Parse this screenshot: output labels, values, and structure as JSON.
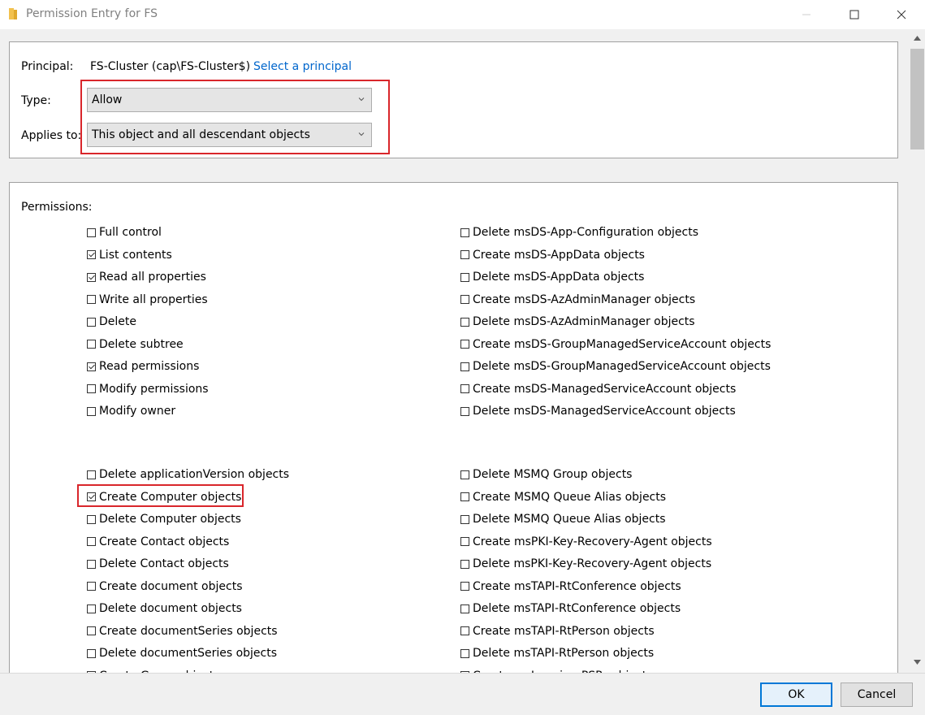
{
  "window": {
    "title": "Permission Entry for FS"
  },
  "principal": {
    "label": "Principal:",
    "value": "FS-Cluster (cap\\FS-Cluster$)",
    "link": "Select a principal"
  },
  "type": {
    "label": "Type:",
    "value": "Allow"
  },
  "applies_to": {
    "label": "Applies to:",
    "value": "This object and all descendant objects"
  },
  "permissions": {
    "header": "Permissions:",
    "left_group1": [
      {
        "label": "Full control",
        "checked": false
      },
      {
        "label": "List contents",
        "checked": true
      },
      {
        "label": "Read all properties",
        "checked": true
      },
      {
        "label": "Write all properties",
        "checked": false
      },
      {
        "label": "Delete",
        "checked": false
      },
      {
        "label": "Delete subtree",
        "checked": false
      },
      {
        "label": "Read permissions",
        "checked": true
      },
      {
        "label": "Modify permissions",
        "checked": false
      },
      {
        "label": "Modify owner",
        "checked": false
      }
    ],
    "right_group1": [
      {
        "label": "Delete msDS-App-Configuration objects",
        "checked": false
      },
      {
        "label": "Create msDS-AppData objects",
        "checked": false
      },
      {
        "label": "Delete msDS-AppData objects",
        "checked": false
      },
      {
        "label": "Create msDS-AzAdminManager objects",
        "checked": false
      },
      {
        "label": "Delete msDS-AzAdminManager objects",
        "checked": false
      },
      {
        "label": "Create msDS-GroupManagedServiceAccount objects",
        "checked": false
      },
      {
        "label": "Delete msDS-GroupManagedServiceAccount objects",
        "checked": false
      },
      {
        "label": "Create msDS-ManagedServiceAccount objects",
        "checked": false
      },
      {
        "label": "Delete msDS-ManagedServiceAccount objects",
        "checked": false
      }
    ],
    "left_group2": [
      {
        "label": "Delete applicationVersion objects",
        "checked": false
      },
      {
        "label": "Create Computer objects",
        "checked": true
      },
      {
        "label": "Delete Computer objects",
        "checked": false
      },
      {
        "label": "Create Contact objects",
        "checked": false
      },
      {
        "label": "Delete Contact objects",
        "checked": false
      },
      {
        "label": "Create document objects",
        "checked": false
      },
      {
        "label": "Delete document objects",
        "checked": false
      },
      {
        "label": "Create documentSeries objects",
        "checked": false
      },
      {
        "label": "Delete documentSeries objects",
        "checked": false
      },
      {
        "label": "Create Group objects",
        "checked": false
      }
    ],
    "right_group2": [
      {
        "label": "Delete MSMQ Group objects",
        "checked": false
      },
      {
        "label": "Create MSMQ Queue Alias objects",
        "checked": false
      },
      {
        "label": "Delete MSMQ Queue Alias objects",
        "checked": false
      },
      {
        "label": "Create msPKI-Key-Recovery-Agent objects",
        "checked": false
      },
      {
        "label": "Delete msPKI-Key-Recovery-Agent objects",
        "checked": false
      },
      {
        "label": "Create msTAPI-RtConference objects",
        "checked": false
      },
      {
        "label": "Delete msTAPI-RtConference objects",
        "checked": false
      },
      {
        "label": "Create msTAPI-RtPerson objects",
        "checked": false
      },
      {
        "label": "Delete msTAPI-RtPerson objects",
        "checked": false
      },
      {
        "label": "Create msImaging-PSPs objects",
        "checked": false
      }
    ]
  },
  "buttons": {
    "ok": "OK",
    "cancel": "Cancel"
  },
  "colors": {
    "highlight": "#d9262b",
    "link": "#0066cc",
    "ok_border": "#0078d7"
  },
  "icons": {
    "title": "folder-icon",
    "minimize": "minimize-icon",
    "maximize": "maximize-icon",
    "close": "close-icon",
    "dropdown": "chevron-down-icon"
  }
}
